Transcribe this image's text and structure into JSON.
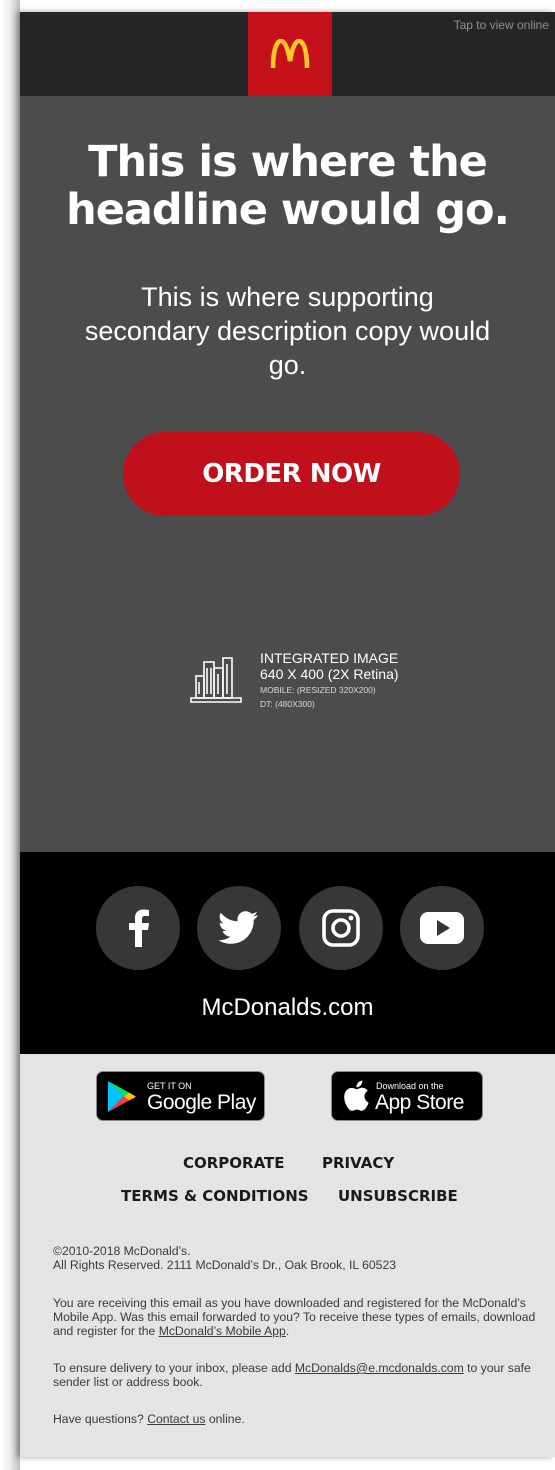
{
  "header": {
    "tap_link": "Tap to view online",
    "logo_name": "mcdonalds-arches-logo",
    "brand_red": "#c5111a",
    "arch_yellow": "#ffc72c"
  },
  "hero": {
    "headline": "This is where the headline would go.",
    "subcopy": "This is where supporting secondary description copy would go.",
    "cta_label": "ORDER NOW",
    "integrated_image": {
      "title": "INTEGRATED IMAGE",
      "size": "640 X 400 (2X Retina)",
      "mobile": "MOBILE: (RESIZED 320X200)",
      "desktop": "DT: (480X300)"
    }
  },
  "social": {
    "icons": [
      "facebook-icon",
      "twitter-icon",
      "instagram-icon",
      "youtube-icon"
    ],
    "site_link": "McDonalds.com"
  },
  "footer": {
    "google_play": {
      "small": "GET IT ON",
      "big": "Google Play"
    },
    "app_store": {
      "small": "Download on the",
      "big": "App Store"
    },
    "links": {
      "corporate": "CORPORATE",
      "privacy": "PRIVACY",
      "terms": "TERMS & CONDITIONS",
      "unsubscribe": "UNSUBSCRIBE"
    },
    "copyright_line1": "©2010-2018 McDonald’s.",
    "copyright_line2": "All Rights Reserved. 2111 McDonald’s Dr., Oak Brook, IL 60523",
    "receiving_text": "You are receiving this email as you have downloaded and registered for the McDonald’s Mobile App. Was this email forwarded to you? To receive these types of emails, download and register for the ",
    "mobile_app_link": "McDonald’s Mobile App",
    "period": ".",
    "delivery_text": "To ensure delivery to your inbox, please add ",
    "email_link": "McDonalds@e.mcdonalds.com",
    "delivery_text_2": " to your safe sender list or address book.",
    "questions_text": "Have questions? ",
    "contact_link": "Contact us",
    "online_text": " online."
  }
}
